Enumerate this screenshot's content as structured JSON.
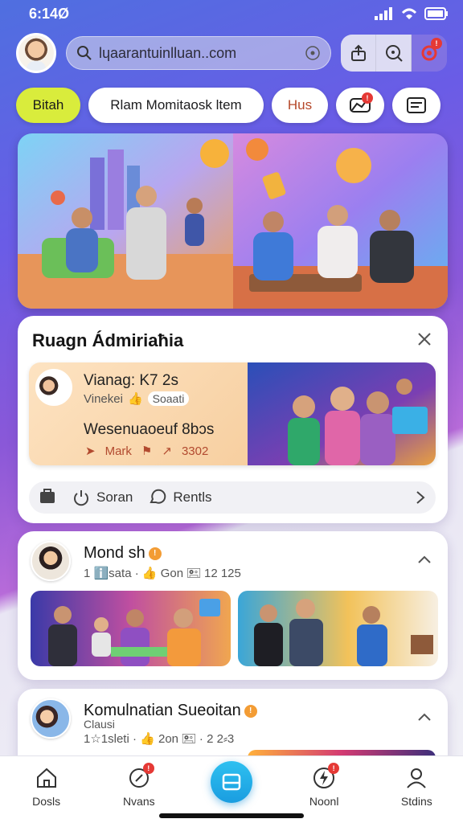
{
  "status": {
    "time": "6:14Ø"
  },
  "search": {
    "value": "lɥaarantuinlluan..com"
  },
  "chips": [
    "Bitah",
    "Rlam Momitaosk ltem",
    "Hus"
  ],
  "card1": {
    "title": "Ruagn Ádmiriaħia",
    "inner": {
      "name": "Vianag: K7 2s",
      "meta_left": "Vinekei",
      "meta_right": "Soaati",
      "subtitle": "Wesenuaoeuf 8bɔs",
      "foot_left": "Mark",
      "foot_right": "3302"
    },
    "actions": {
      "left_label": "Soran",
      "right_label": "Rentls"
    }
  },
  "post1": {
    "name": "Mond sh",
    "meta": "1 ℹ️sata · 👍 Gon 🖭 12 125"
  },
  "post2": {
    "name": "Komulnatian Sueoitan",
    "subtitle": "Clausi",
    "meta": "1☆1sleti · 👍 2on 🖭 · 2 2⸗3"
  },
  "nav": [
    {
      "label": "Dosls",
      "icon": "home-icon"
    },
    {
      "label": "Nvans",
      "icon": "search-chat-icon"
    },
    {
      "label": "",
      "icon": "compose-icon"
    },
    {
      "label": "Noonl",
      "icon": "lightning-icon"
    },
    {
      "label": "Stdins",
      "icon": "profile-icon"
    }
  ],
  "colors": {
    "accent": "#d9ec3c",
    "fab": "#1a9de0",
    "badge": "#e53935"
  }
}
